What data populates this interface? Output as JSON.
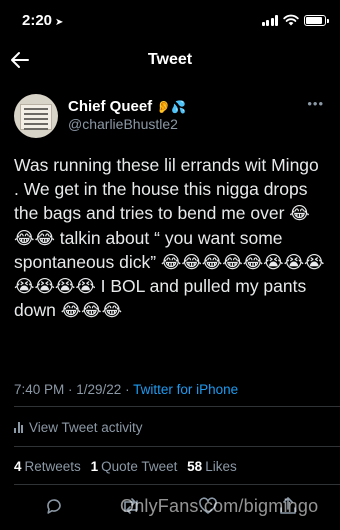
{
  "status_bar": {
    "time": "2:20",
    "location_arrow": "location-arrow-icon",
    "signal_icon": "signal-icon",
    "wifi_icon": "wifi-icon",
    "battery_icon": "battery-icon",
    "battery_level": 0.9
  },
  "nav": {
    "title": "Tweet",
    "back_icon": "back-arrow-icon"
  },
  "author": {
    "display_name": "Chief Queef",
    "name_emoji": "👂💦",
    "handle": "@charlieBhustle2",
    "more_icon": "more-icon"
  },
  "tweet": {
    "text": "Was running these lil errands wit Mingo . We get in the house this nigga drops the bags and tries to bend me over 😂😂😂 talkin about “ you want some spontaneous dick” 😂😂😂😂😂😭😭😭😭😭😭😭 I BOL and pulled my pants down 😂😂😂"
  },
  "meta": {
    "timestamp": "7:40 PM · 1/29/22 · ",
    "source": "Twitter for iPhone"
  },
  "activity": {
    "label": "View Tweet activity",
    "icon": "analytics-icon"
  },
  "stats": {
    "retweets_count": "4",
    "retweets_label": "Retweets",
    "quotes_count": "1",
    "quotes_label": "Quote Tweet",
    "likes_count": "58",
    "likes_label": "Likes"
  },
  "actions": {
    "reply_icon": "reply-icon",
    "retweet_icon": "retweet-icon",
    "like_icon": "like-icon",
    "share_icon": "share-icon"
  },
  "watermark": "OnlyFans.com/bigmingo",
  "colors": {
    "background": "#000000",
    "text": "#e7e9ea",
    "secondary": "#8b98a5",
    "link": "#1d9bf0",
    "divider": "#2f3336"
  }
}
